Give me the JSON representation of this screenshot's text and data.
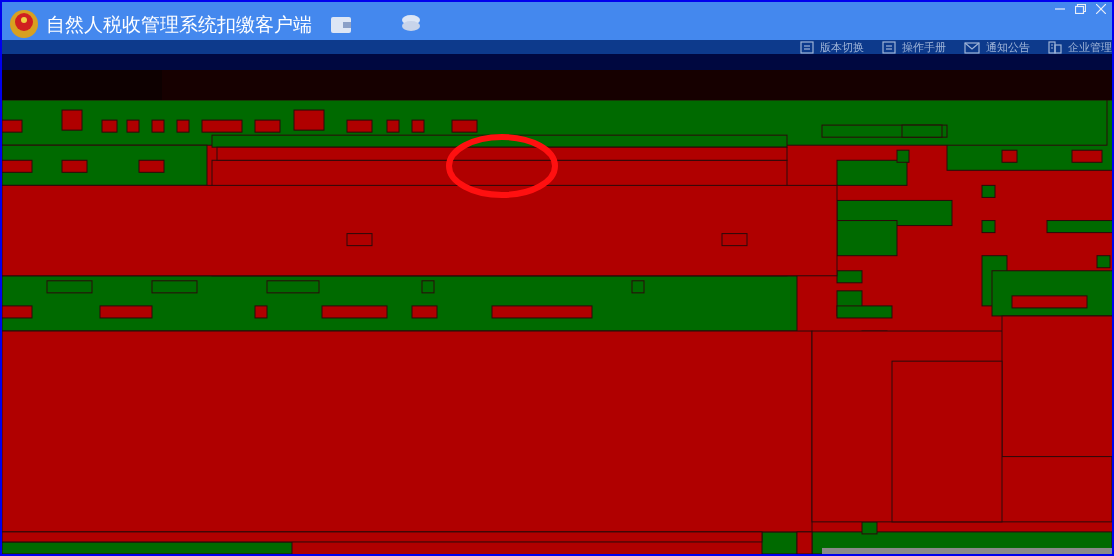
{
  "window": {
    "title": "自然人税收管理系统扣缴客户端"
  },
  "header_links": [
    {
      "label": "版本切换"
    },
    {
      "label": "操作手册"
    },
    {
      "label": "通知公告"
    },
    {
      "label": "企业管理"
    }
  ]
}
